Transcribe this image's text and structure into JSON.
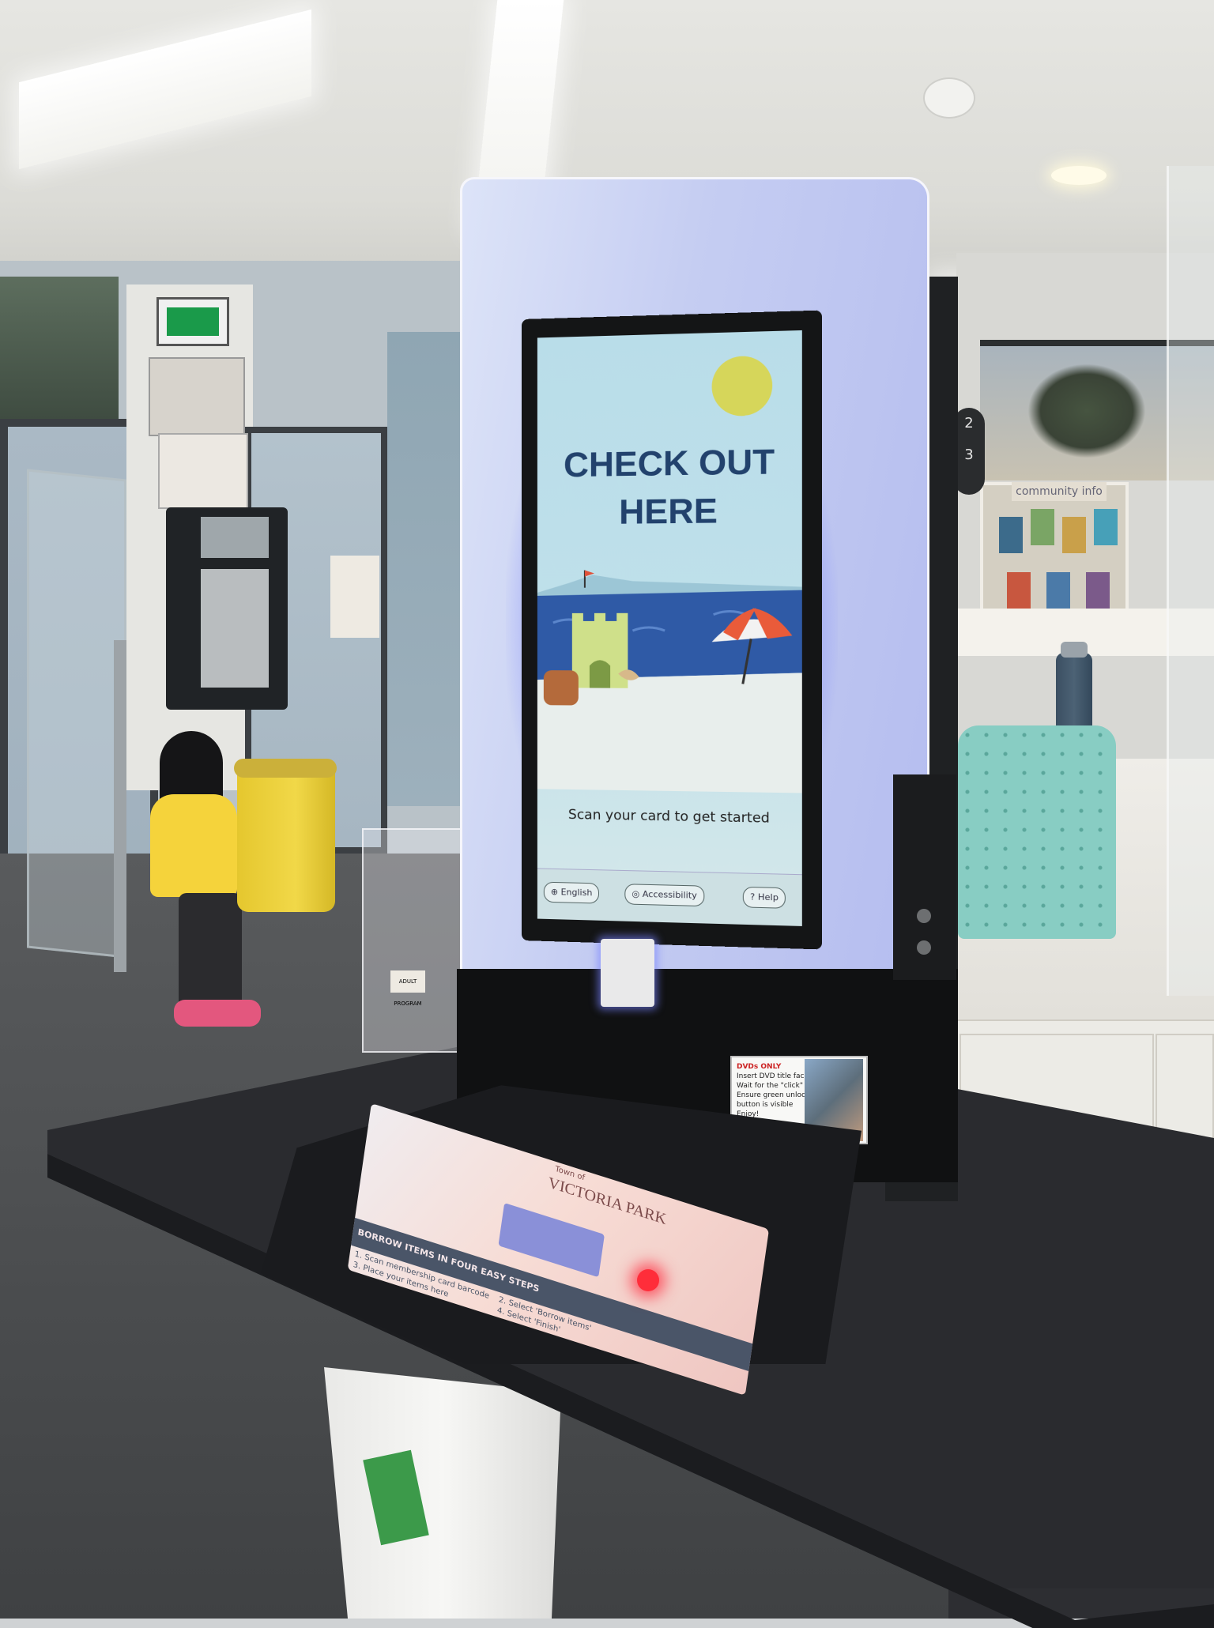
{
  "kiosk": {
    "screen": {
      "title_line1": "CHECK OUT",
      "title_line2": "HERE",
      "prompt": "Scan your card to get started",
      "footer": {
        "language_button": "English",
        "accessibility_button": "Accessibility",
        "help_button": "Help"
      },
      "colors": {
        "title": "#22426d",
        "sky": "#b9dde9",
        "sea": "#2f5aa6",
        "sun": "#d6d65a",
        "accent_glow": "#4650ff"
      }
    },
    "dvd_sign": {
      "heading": "DVDs ONLY",
      "line1": "Insert DVD title face-up",
      "line2": "Wait for the \"click\" sound",
      "line3": "Ensure green unlock",
      "line4": "button is visible",
      "line5": "Enjoy!"
    },
    "mat": {
      "logo_small": "Town of",
      "logo": "VICTORIA PARK",
      "band_title": "BORROW ITEMS IN FOUR EASY STEPS",
      "step1": "1. Scan membership card barcode",
      "step2": "2. Select 'Borrow items'",
      "step3": "3. Place your items here",
      "step4": "4. Select 'Finish'"
    }
  },
  "room": {
    "community_board_label": "community info",
    "acrylic_holder_tag": "ADULT PROGRAM",
    "clock_digits": "2\n3"
  },
  "icons": {
    "exit": "exit-sign-icon",
    "globe": "globe-icon",
    "accessibility": "accessibility-icon",
    "help": "help-icon"
  }
}
